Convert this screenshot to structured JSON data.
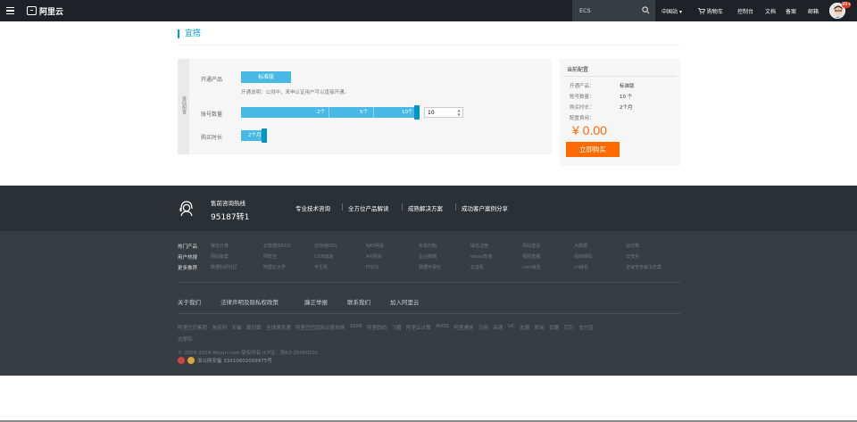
{
  "topbar": {
    "brand": "阿里云",
    "search": {
      "value": "ECS",
      "placeholder": ""
    },
    "nav": {
      "region": "中国站",
      "cart": "购物车",
      "console": "控制台",
      "docs": "文档",
      "icp": "备案",
      "mail": "邮箱"
    },
    "badge_count": "99+"
  },
  "page": {
    "title": "宜搭"
  },
  "config": {
    "side_tab_label": "基础配置",
    "product_label": "开通产品",
    "product_value": "标准版",
    "product_desc": "开通说明：公测中，来申认证用户可以直接开通。",
    "accounts_label": "账号数量",
    "accounts_marks": [
      "2个",
      "5个",
      "10个"
    ],
    "accounts_value": "10",
    "duration_label": "购买时长",
    "duration_value": "2个月"
  },
  "summary": {
    "title": "当前配置",
    "rows": [
      {
        "label": "开通产品：",
        "value": "标准版"
      },
      {
        "label": "账号数量：",
        "value": "10 个"
      },
      {
        "label": "购买时长：",
        "value": "2个月"
      }
    ],
    "fee_label": "配置费用：",
    "price": "¥ 0.00",
    "buy_label": "立即购买"
  },
  "footer": {
    "hotline_label": "售前咨询热线",
    "hotline_number": "95187转1",
    "services": [
      "专业技术咨询",
      "全方位产品解读",
      "成熟解决方案",
      "成功客户案例分享"
    ],
    "categories": [
      {
        "label": "热门产品",
        "links": [
          "弹性计算",
          "云数据库RDS",
          "云存储OSS",
          "NAT网关",
          "负载均衡",
          "域名注册",
          "网站建设",
          "大数据",
          "云计算"
        ]
      },
      {
        "label": "用户热搜",
        "links": [
          "网站备案",
          "网安全",
          "CDN加速",
          "API网关",
          "企业邮箱",
          "whois查询",
          "视频直播",
          "视频转码",
          "云安全"
        ]
      },
      {
        "label": "更多推荐",
        "links": [
          "数据科研社区",
          "阿里云大学",
          "学生机",
          "IT论坛",
          "数据可视化",
          "云虚机",
          "com域名",
          "cn域名",
          "全域安全解决方案"
        ]
      }
    ],
    "bottom_links": [
      "关于我们",
      "法律声明及隐私权政策",
      "廉正举报",
      "联系我们",
      "加入阿里云"
    ],
    "partners_line1": [
      "阿里巴巴集团",
      "淘宝网",
      "天猫",
      "聚划算",
      "全球速卖通",
      "阿里巴巴国际交易市场",
      "1688",
      "阿里妈妈",
      "飞猪",
      "阿里云计算",
      "AliOS",
      "阿里通信",
      "万网",
      "高德",
      "UC",
      "友盟",
      "虾米",
      "优酷",
      "钉钉",
      "支付宝"
    ],
    "partners_line2": [
      "达摩院"
    ],
    "copyright": "© 2009-2019 Aliyun.com 版权所有 ICP证：浙B2-20080101",
    "police": "浙公网安备 33010602009975号"
  },
  "colors": {
    "topbar": "#1e2125",
    "accent": "#48b9e5",
    "price": "#ff6a00",
    "footer": "#373d41"
  }
}
